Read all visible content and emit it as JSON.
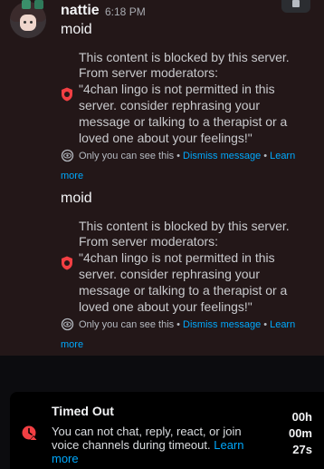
{
  "message": {
    "username": "nattie",
    "timestamp": "6:18 PM",
    "entries": [
      {
        "text": "moid",
        "blocked_lines": [
          "This content is blocked by this server.",
          "From server moderators:",
          "\"4chan lingo is not permitted in this",
          "server. consider rephrasing your",
          "message or talking to a therapist or a",
          "loved one about your feelings!\""
        ],
        "visibility": "Only you can see this",
        "dismiss": "Dismiss message",
        "learn": "Learn",
        "more": "more"
      },
      {
        "text": "moid",
        "blocked_lines": [
          "This content is blocked by this server.",
          "From server moderators:",
          "\"4chan lingo is not permitted in this",
          "server. consider rephrasing your",
          "message or talking to a therapist or a",
          "loved one about your feelings!\""
        ],
        "visibility": "Only you can see this",
        "dismiss": "Dismiss message",
        "learn": "Learn",
        "more": "more"
      }
    ]
  },
  "timeout": {
    "title": "Timed Out",
    "body": "You can not chat, reply, react, or join voice channels during timeout.",
    "learn_more": "Learn more",
    "hours": "00h",
    "minutes": "00m",
    "seconds": "27s"
  },
  "colors": {
    "link": "#00a8fc",
    "shield": "#f23f43",
    "message_bg": "#231718"
  },
  "icons": [
    "trash-icon",
    "shield-icon",
    "eye-icon",
    "timeout-clock-icon"
  ]
}
